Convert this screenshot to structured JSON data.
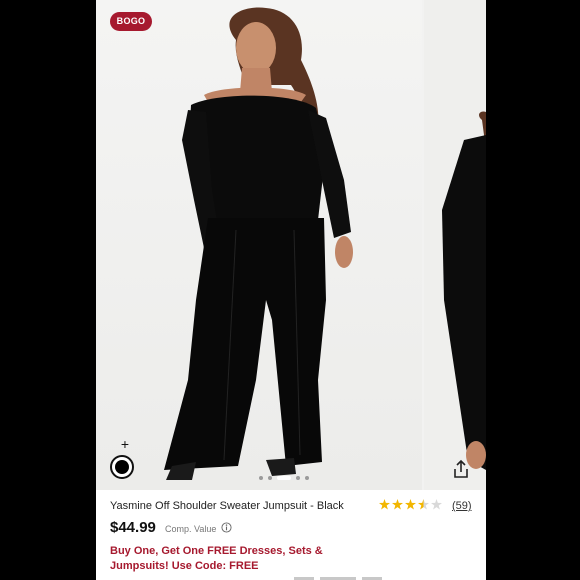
{
  "product": {
    "badge": "BOGO",
    "name": "Yasmine Off Shoulder Sweater Jumpsuit - Black",
    "rating_value": 3.5,
    "rating_max": 5,
    "review_count": "(59)",
    "price": "$44.99",
    "comp_value_label": "Comp. Value",
    "promo_text": "Buy One, Get One FREE Dresses, Sets & Jumpsuits! Use Code: FREE"
  },
  "gallery": {
    "color_add_symbol": "+",
    "slide_count": 5,
    "active_slide": 3
  },
  "colors": {
    "badge": "#a6192e",
    "promo": "#a6192e",
    "star": "#f2b600",
    "garment": "#0a0a0a"
  },
  "icons": {
    "share": "share-icon",
    "info": "info-icon",
    "swatch": "black-color-swatch"
  }
}
